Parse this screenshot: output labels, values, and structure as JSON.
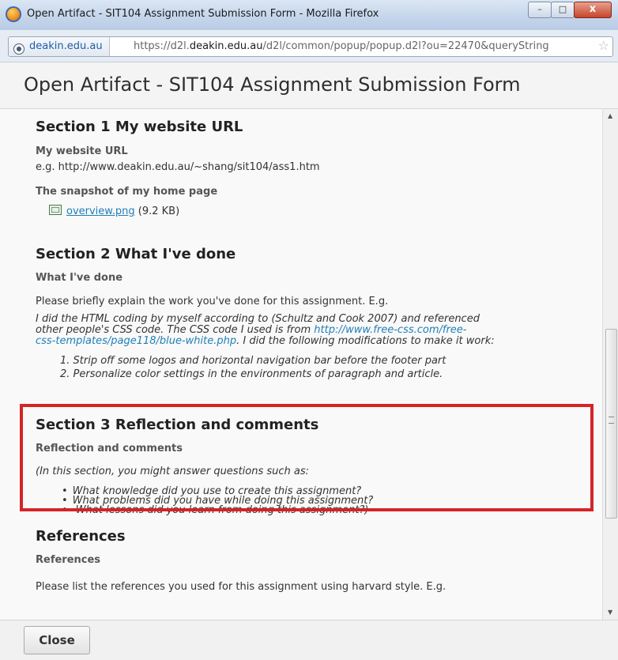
{
  "window": {
    "title": "Open Artifact - SIT104 Assignment Submission Form - Mozilla Firefox",
    "buttons": {
      "minimize": "–",
      "maximize": "□",
      "close": "x"
    }
  },
  "address_bar": {
    "site_identity": "deakin.edu.au",
    "url_prefix": "https://d2l.",
    "url_domain": "deakin.edu.au",
    "url_rest": "/d2l/common/popup/popup.d2l?ou=22470&queryString"
  },
  "dialog": {
    "title": "Open Artifact - SIT104 Assignment Submission Form"
  },
  "section1": {
    "heading": "Section 1 My website URL",
    "field1_label": "My website URL",
    "field1_value": "e.g. http://www.deakin.edu.au/~shang/sit104/ass1.htm",
    "field2_label": "The snapshot of my home page",
    "file_name": "overview.png",
    "file_size": "(9.2 KB)"
  },
  "section2": {
    "heading": "Section 2 What I've done",
    "field_label": "What I've done",
    "intro": "Please briefly explain the work you've done for this assignment. E.g.",
    "para_line1": "I did the HTML coding by myself according to (Schultz and Cook 2007) and referenced",
    "para_line2_a": "other people's CSS code. The CSS code I used is from ",
    "para_line2_link": "http://www.free-css.com/free-",
    "para_line3_link": "css-templates/page118/blue-white.php",
    "para_line3_b": ". I did the following modifications to make it work:",
    "list": [
      "1.  Strip off some logos and horizontal navigation bar before the footer part",
      "2.  Personalize color settings in the environments of paragraph and article."
    ]
  },
  "section3": {
    "heading": "Section 3 Reflection and comments",
    "field_label": "Reflection and comments",
    "intro": "(In this section, you might answer questions such as:",
    "bullets": [
      "What knowledge did you use to create this assignment?",
      "What problems did you have while doing this assignment?",
      " What lessons did you learn from doing this assignment?)"
    ],
    "highlight_color": "#d42426"
  },
  "references": {
    "heading": "References",
    "field_label": "References",
    "intro": "Please list the references you used for this assignment using harvard style. E.g."
  },
  "footer": {
    "close_label": "Close"
  }
}
